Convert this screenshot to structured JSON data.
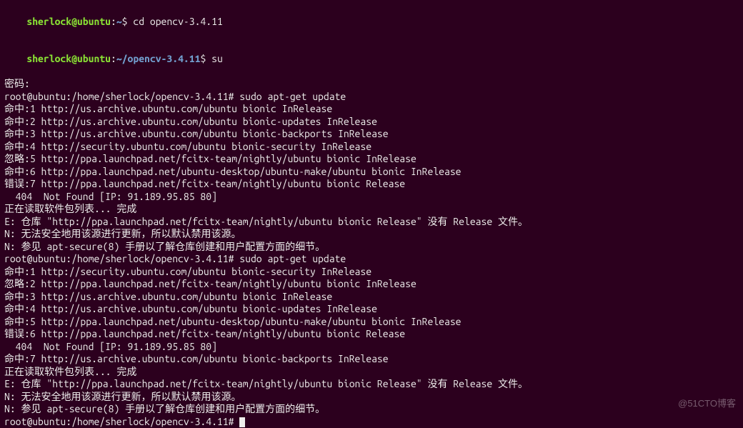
{
  "prompt1": {
    "user": "sherlock@ubuntu",
    "path": "~",
    "sep": ":",
    "sigil": "$",
    "cmd": " cd opencv-3.4.11"
  },
  "prompt2": {
    "user": "sherlock@ubuntu",
    "path": "~/opencv-3.4.11",
    "sep": ":",
    "sigil": "$",
    "cmd": " su"
  },
  "lines": {
    "l01": "密码:",
    "l02": "root@ubuntu:/home/sherlock/opencv-3.4.11# sudo apt-get update",
    "l03": "命中:1 http://us.archive.ubuntu.com/ubuntu bionic InRelease",
    "l04": "命中:2 http://us.archive.ubuntu.com/ubuntu bionic-updates InRelease",
    "l05": "命中:3 http://us.archive.ubuntu.com/ubuntu bionic-backports InRelease",
    "l06": "命中:4 http://security.ubuntu.com/ubuntu bionic-security InRelease",
    "l07": "忽略:5 http://ppa.launchpad.net/fcitx-team/nightly/ubuntu bionic InRelease",
    "l08": "命中:6 http://ppa.launchpad.net/ubuntu-desktop/ubuntu-make/ubuntu bionic InRelease",
    "l09": "错误:7 http://ppa.launchpad.net/fcitx-team/nightly/ubuntu bionic Release",
    "l10": "  404  Not Found [IP: 91.189.95.85 80]",
    "l11": "正在读取软件包列表... 完成",
    "l12": "E: 仓库 \"http://ppa.launchpad.net/fcitx-team/nightly/ubuntu bionic Release\" 没有 Release 文件。",
    "l13": "N: 无法安全地用该源进行更新，所以默认禁用该源。",
    "l14": "N: 参见 apt-secure(8) 手册以了解仓库创建和用户配置方面的细节。",
    "l15": "root@ubuntu:/home/sherlock/opencv-3.4.11# sudo apt-get update",
    "l16": "命中:1 http://security.ubuntu.com/ubuntu bionic-security InRelease",
    "l17": "忽略:2 http://ppa.launchpad.net/fcitx-team/nightly/ubuntu bionic InRelease",
    "l18": "命中:3 http://us.archive.ubuntu.com/ubuntu bionic InRelease",
    "l19": "命中:4 http://us.archive.ubuntu.com/ubuntu bionic-updates InRelease",
    "l20": "命中:5 http://ppa.launchpad.net/ubuntu-desktop/ubuntu-make/ubuntu bionic InRelease",
    "l21": "错误:6 http://ppa.launchpad.net/fcitx-team/nightly/ubuntu bionic Release",
    "l22": "  404  Not Found [IP: 91.189.95.85 80]",
    "l23": "命中:7 http://us.archive.ubuntu.com/ubuntu bionic-backports InRelease",
    "l24": "正在读取软件包列表... 完成",
    "l25": "E: 仓库 \"http://ppa.launchpad.net/fcitx-team/nightly/ubuntu bionic Release\" 没有 Release 文件。",
    "l26": "N: 无法安全地用该源进行更新，所以默认禁用该源。",
    "l27": "N: 参见 apt-secure(8) 手册以了解仓库创建和用户配置方面的细节。",
    "l28": "root@ubuntu:/home/sherlock/opencv-3.4.11# "
  },
  "watermark": "@51CTO博客"
}
